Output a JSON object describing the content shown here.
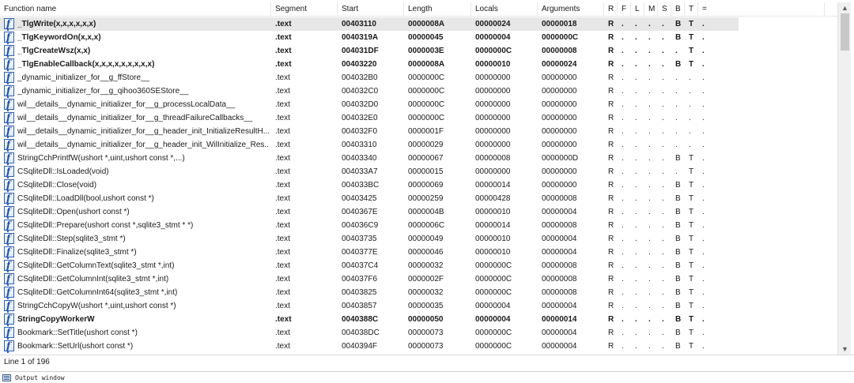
{
  "columns": [
    {
      "key": "name",
      "label": "Function name"
    },
    {
      "key": "segment",
      "label": "Segment"
    },
    {
      "key": "start",
      "label": "Start"
    },
    {
      "key": "length",
      "label": "Length"
    },
    {
      "key": "locals",
      "label": "Locals"
    },
    {
      "key": "arguments",
      "label": "Arguments"
    },
    {
      "key": "R",
      "label": "R"
    },
    {
      "key": "F",
      "label": "F"
    },
    {
      "key": "L",
      "label": "L"
    },
    {
      "key": "M",
      "label": "M"
    },
    {
      "key": "S",
      "label": "S"
    },
    {
      "key": "B",
      "label": "B"
    },
    {
      "key": "T",
      "label": "T"
    },
    {
      "key": "eq",
      "label": "="
    }
  ],
  "icons": {
    "function": "function-icon",
    "output": "output-window-icon",
    "scroll_up": "scroll-up-arrow",
    "scroll_down": "scroll-down-arrow"
  },
  "colors": {
    "selected_row": "#e7e7e7",
    "icon_blue": "#2f5fb3"
  },
  "selected_row_index": 0,
  "rows": [
    {
      "name": "_TlgWrite(x,x,x,x,x,x)",
      "segment": ".text",
      "start": "00403110",
      "length": "0000008A",
      "locals": "00000024",
      "arguments": "00000018",
      "flags": [
        "R",
        ".",
        ".",
        ".",
        ".",
        "B",
        "T",
        "."
      ],
      "bold": true
    },
    {
      "name": "_TlgKeywordOn(x,x,x)",
      "segment": ".text",
      "start": "0040319A",
      "length": "00000045",
      "locals": "00000004",
      "arguments": "0000000C",
      "flags": [
        "R",
        ".",
        ".",
        ".",
        ".",
        "B",
        "T",
        "."
      ],
      "bold": true
    },
    {
      "name": "_TlgCreateWsz(x,x)",
      "segment": ".text",
      "start": "004031DF",
      "length": "0000003E",
      "locals": "0000000C",
      "arguments": "00000008",
      "flags": [
        "R",
        ".",
        ".",
        ".",
        ".",
        ".",
        "T",
        "."
      ],
      "bold": true
    },
    {
      "name": "_TlgEnableCallback(x,x,x,x,x,x,x,x,x)",
      "segment": ".text",
      "start": "00403220",
      "length": "0000008A",
      "locals": "00000010",
      "arguments": "00000024",
      "flags": [
        "R",
        ".",
        ".",
        ".",
        ".",
        "B",
        "T",
        "."
      ],
      "bold": true
    },
    {
      "name": "_dynamic_initializer_for__g_ffStore__",
      "segment": ".text",
      "start": "004032B0",
      "length": "0000000C",
      "locals": "00000000",
      "arguments": "00000000",
      "flags": [
        "R",
        ".",
        ".",
        ".",
        ".",
        ".",
        ".",
        "."
      ],
      "bold": false
    },
    {
      "name": "_dynamic_initializer_for__g_qihoo360SEStore__",
      "segment": ".text",
      "start": "004032C0",
      "length": "0000000C",
      "locals": "00000000",
      "arguments": "00000000",
      "flags": [
        "R",
        ".",
        ".",
        ".",
        ".",
        ".",
        ".",
        "."
      ],
      "bold": false
    },
    {
      "name": "wil__details__dynamic_initializer_for__g_processLocalData__",
      "segment": ".text",
      "start": "004032D0",
      "length": "0000000C",
      "locals": "00000000",
      "arguments": "00000000",
      "flags": [
        "R",
        ".",
        ".",
        ".",
        ".",
        ".",
        ".",
        "."
      ],
      "bold": false
    },
    {
      "name": "wil__details__dynamic_initializer_for__g_threadFailureCallbacks__",
      "segment": ".text",
      "start": "004032E0",
      "length": "0000000C",
      "locals": "00000000",
      "arguments": "00000000",
      "flags": [
        "R",
        ".",
        ".",
        ".",
        ".",
        ".",
        ".",
        "."
      ],
      "bold": false
    },
    {
      "name": "wil__details__dynamic_initializer_for__g_header_init_InitializeResultH...",
      "segment": ".text",
      "start": "004032F0",
      "length": "0000001F",
      "locals": "00000000",
      "arguments": "00000000",
      "flags": [
        "R",
        ".",
        ".",
        ".",
        ".",
        ".",
        ".",
        "."
      ],
      "bold": false
    },
    {
      "name": "wil__details__dynamic_initializer_for__g_header_init_WilInitialize_Res...",
      "segment": ".text",
      "start": "00403310",
      "length": "00000029",
      "locals": "00000000",
      "arguments": "00000000",
      "flags": [
        "R",
        ".",
        ".",
        ".",
        ".",
        ".",
        ".",
        "."
      ],
      "bold": false
    },
    {
      "name": "StringCchPrintfW(ushort *,uint,ushort const *,...)",
      "segment": ".text",
      "start": "00403340",
      "length": "00000067",
      "locals": "00000008",
      "arguments": "0000000D",
      "flags": [
        "R",
        ".",
        ".",
        ".",
        ".",
        "B",
        "T",
        "."
      ],
      "bold": false
    },
    {
      "name": "CSqliteDll::IsLoaded(void)",
      "segment": ".text",
      "start": "004033A7",
      "length": "00000015",
      "locals": "00000000",
      "arguments": "00000000",
      "flags": [
        "R",
        ".",
        ".",
        ".",
        ".",
        ".",
        "T",
        "."
      ],
      "bold": false
    },
    {
      "name": "CSqliteDll::Close(void)",
      "segment": ".text",
      "start": "004033BC",
      "length": "00000069",
      "locals": "00000014",
      "arguments": "00000000",
      "flags": [
        "R",
        ".",
        ".",
        ".",
        ".",
        "B",
        "T",
        "."
      ],
      "bold": false
    },
    {
      "name": "CSqliteDll::LoadDll(bool,ushort const *)",
      "segment": ".text",
      "start": "00403425",
      "length": "00000259",
      "locals": "00000428",
      "arguments": "00000008",
      "flags": [
        "R",
        ".",
        ".",
        ".",
        ".",
        "B",
        "T",
        "."
      ],
      "bold": false
    },
    {
      "name": "CSqliteDll::Open(ushort const *)",
      "segment": ".text",
      "start": "0040367E",
      "length": "0000004B",
      "locals": "00000010",
      "arguments": "00000004",
      "flags": [
        "R",
        ".",
        ".",
        ".",
        ".",
        "B",
        "T",
        "."
      ],
      "bold": false
    },
    {
      "name": "CSqliteDll::Prepare(ushort const *,sqlite3_stmt * *)",
      "segment": ".text",
      "start": "004036C9",
      "length": "0000006C",
      "locals": "00000014",
      "arguments": "00000008",
      "flags": [
        "R",
        ".",
        ".",
        ".",
        ".",
        "B",
        "T",
        "."
      ],
      "bold": false
    },
    {
      "name": "CSqliteDll::Step(sqlite3_stmt *)",
      "segment": ".text",
      "start": "00403735",
      "length": "00000049",
      "locals": "00000010",
      "arguments": "00000004",
      "flags": [
        "R",
        ".",
        ".",
        ".",
        ".",
        "B",
        "T",
        "."
      ],
      "bold": false
    },
    {
      "name": "CSqliteDll::Finalize(sqlite3_stmt *)",
      "segment": ".text",
      "start": "0040377E",
      "length": "00000046",
      "locals": "00000010",
      "arguments": "00000004",
      "flags": [
        "R",
        ".",
        ".",
        ".",
        ".",
        "B",
        "T",
        "."
      ],
      "bold": false
    },
    {
      "name": "CSqliteDll::GetColumnText(sqlite3_stmt *,int)",
      "segment": ".text",
      "start": "004037C4",
      "length": "00000032",
      "locals": "0000000C",
      "arguments": "00000008",
      "flags": [
        "R",
        ".",
        ".",
        ".",
        ".",
        "B",
        "T",
        "."
      ],
      "bold": false
    },
    {
      "name": "CSqliteDll::GetColumnInt(sqlite3_stmt *,int)",
      "segment": ".text",
      "start": "004037F6",
      "length": "0000002F",
      "locals": "0000000C",
      "arguments": "00000008",
      "flags": [
        "R",
        ".",
        ".",
        ".",
        ".",
        "B",
        "T",
        "."
      ],
      "bold": false
    },
    {
      "name": "CSqliteDll::GetColumnInt64(sqlite3_stmt *,int)",
      "segment": ".text",
      "start": "00403825",
      "length": "00000032",
      "locals": "0000000C",
      "arguments": "00000008",
      "flags": [
        "R",
        ".",
        ".",
        ".",
        ".",
        "B",
        "T",
        "."
      ],
      "bold": false
    },
    {
      "name": "StringCchCopyW(ushort *,uint,ushort const *)",
      "segment": ".text",
      "start": "00403857",
      "length": "00000035",
      "locals": "00000004",
      "arguments": "00000004",
      "flags": [
        "R",
        ".",
        ".",
        ".",
        ".",
        "B",
        "T",
        "."
      ],
      "bold": false
    },
    {
      "name": "StringCopyWorkerW",
      "segment": ".text",
      "start": "0040388C",
      "length": "00000050",
      "locals": "00000004",
      "arguments": "00000014",
      "flags": [
        "R",
        ".",
        ".",
        ".",
        ".",
        "B",
        "T",
        "."
      ],
      "bold": true
    },
    {
      "name": "Bookmark::SetTitle(ushort const *)",
      "segment": ".text",
      "start": "004038DC",
      "length": "00000073",
      "locals": "0000000C",
      "arguments": "00000004",
      "flags": [
        "R",
        ".",
        ".",
        ".",
        ".",
        "B",
        "T",
        "."
      ],
      "bold": false
    },
    {
      "name": "Bookmark::SetUrl(ushort const *)",
      "segment": ".text",
      "start": "0040394F",
      "length": "00000073",
      "locals": "0000000C",
      "arguments": "00000004",
      "flags": [
        "R",
        ".",
        ".",
        ".",
        ".",
        "B",
        "T",
        "."
      ],
      "bold": false
    }
  ],
  "status": {
    "line_info": "Line 1 of 196"
  },
  "output_window": {
    "label": "Output window"
  }
}
